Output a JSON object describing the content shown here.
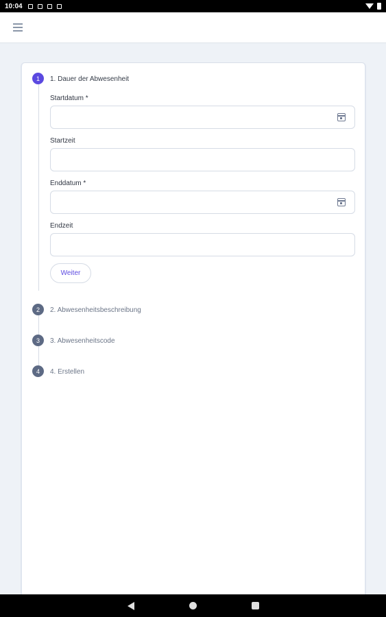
{
  "status_bar": {
    "time": "10:04"
  },
  "form": {
    "steps": [
      {
        "number": "1",
        "label": "1. Dauer der Abwesenheit"
      },
      {
        "number": "2",
        "label": "2. Abwesenheitsbeschreibung"
      },
      {
        "number": "3",
        "label": "3. Abwesenheitscode"
      },
      {
        "number": "4",
        "label": "4. Erstellen"
      }
    ],
    "fields": {
      "start_date": {
        "label": "Startdatum *",
        "value": ""
      },
      "start_time": {
        "label": "Startzeit",
        "value": ""
      },
      "end_date": {
        "label": "Enddatum *",
        "value": ""
      },
      "end_time": {
        "label": "Endzeit",
        "value": ""
      }
    },
    "next_button": "Weiter"
  },
  "icons": {
    "menu": "hamburger-menu-icon",
    "calendar": "calendar-icon",
    "back": "nav-back-icon",
    "home": "nav-home-icon",
    "recents": "nav-recents-icon"
  },
  "colors": {
    "accent": "#5b49e0",
    "inactive_step": "#5d6a84",
    "background": "#eef2f7"
  }
}
